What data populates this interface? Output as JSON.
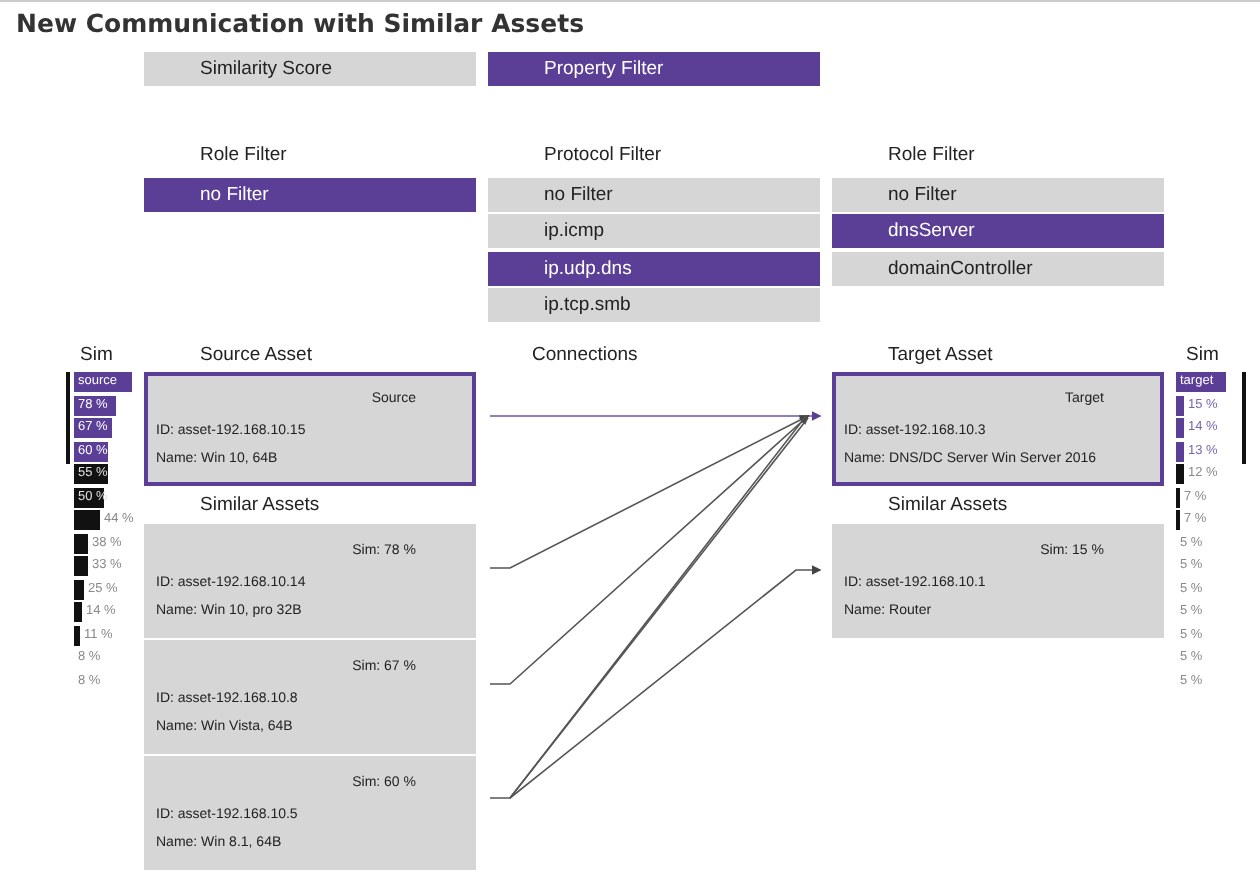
{
  "title": "New Communication with Similar Assets",
  "modes": [
    {
      "label": "Similarity Score",
      "selected": false
    },
    {
      "label": "Property Filter",
      "selected": true
    }
  ],
  "filters": [
    {
      "heading": "Role Filter",
      "options": [
        {
          "label": "no Filter",
          "selected": true
        }
      ]
    },
    {
      "heading": "Protocol Filter",
      "options": [
        {
          "label": "no Filter",
          "selected": false
        },
        {
          "label": "ip.icmp",
          "selected": false
        },
        {
          "label": "ip.udp.dns",
          "selected": true
        },
        {
          "label": "ip.tcp.smb",
          "selected": false
        }
      ]
    },
    {
      "heading": "Role Filter",
      "options": [
        {
          "label": "no Filter",
          "selected": false
        },
        {
          "label": "dnsServer",
          "selected": true
        },
        {
          "label": "domainController",
          "selected": false
        }
      ]
    }
  ],
  "source_sim": {
    "heading": "Sim",
    "rows": [
      {
        "label": "source",
        "selected": true
      },
      {
        "label": "78 %",
        "selected": true
      },
      {
        "label": "67 %",
        "selected": true
      },
      {
        "label": "60 %",
        "selected": true
      },
      {
        "label": "55 %",
        "selected": false
      },
      {
        "label": "50 %",
        "selected": false
      },
      {
        "label": "44 %",
        "selected": false
      },
      {
        "label": "38 %",
        "selected": false
      },
      {
        "label": "33 %",
        "selected": false
      },
      {
        "label": "25 %",
        "selected": false
      },
      {
        "label": "14 %",
        "selected": false
      },
      {
        "label": "11 %",
        "selected": false
      },
      {
        "label": "8 %",
        "selected": false
      },
      {
        "label": "8 %",
        "selected": false
      }
    ]
  },
  "source": {
    "heading": "Source Asset",
    "card": {
      "tag": "Source",
      "id": "ID: asset-192.168.10.15",
      "name": "Name: Win 10, 64B"
    },
    "similar_heading": "Similar Assets",
    "similar": [
      {
        "tag": "Sim: 78 %",
        "id": "ID: asset-192.168.10.14",
        "name": "Name: Win 10, pro 32B"
      },
      {
        "tag": "Sim: 67 %",
        "id": "ID: asset-192.168.10.8",
        "name": "Name: Win Vista, 64B"
      },
      {
        "tag": "Sim: 60 %",
        "id": "ID: asset-192.168.10.5",
        "name": "Name: Win 8.1, 64B"
      }
    ]
  },
  "connections": {
    "heading": "Connections"
  },
  "target": {
    "heading": "Target Asset",
    "card": {
      "tag": "Target",
      "id": "ID: asset-192.168.10.3",
      "name": "Name: DNS/DC Server Win Server 2016"
    },
    "similar_heading": "Similar Assets",
    "similar": [
      {
        "tag": "Sim: 15 %",
        "id": "ID: asset-192.168.10.1",
        "name": "Name: Router"
      }
    ]
  },
  "target_sim": {
    "heading": "Sim",
    "rows": [
      {
        "label": "target",
        "selected": true
      },
      {
        "label": "15 %",
        "selected": true
      },
      {
        "label": "14 %",
        "selected": true
      },
      {
        "label": "13 %",
        "selected": true
      },
      {
        "label": "12 %",
        "selected": false
      },
      {
        "label": "7 %",
        "selected": false
      },
      {
        "label": "7 %",
        "selected": false
      },
      {
        "label": "5 %",
        "selected": false
      },
      {
        "label": "5 %",
        "selected": false
      },
      {
        "label": "5 %",
        "selected": false
      },
      {
        "label": "5 %",
        "selected": false
      },
      {
        "label": "5 %",
        "selected": false
      },
      {
        "label": "5 %",
        "selected": false
      },
      {
        "label": "5 %",
        "selected": false
      }
    ]
  }
}
